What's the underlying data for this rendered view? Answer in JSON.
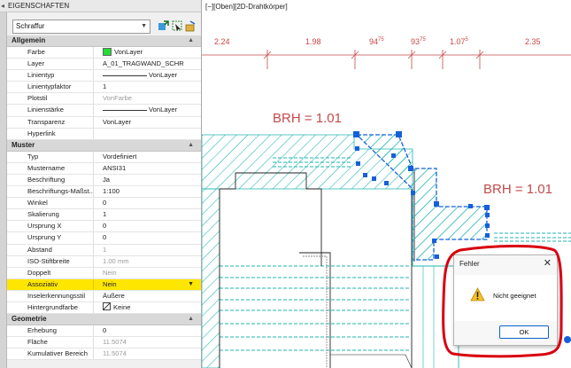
{
  "palette": {
    "title": "EIGENSCHAFTEN",
    "selection": "Schraffur",
    "sections": [
      {
        "name": "Allgemein",
        "rows": [
          {
            "label": "Farbe",
            "value": "VonLayer",
            "kind": "color"
          },
          {
            "label": "Layer",
            "value": "A_01_TRAGWAND_SCHR"
          },
          {
            "label": "Linientyp",
            "value": "VonLayer",
            "kind": "line"
          },
          {
            "label": "Linientypfaktor",
            "value": "1"
          },
          {
            "label": "Plotstil",
            "value": "VonFarbe",
            "readonly": true
          },
          {
            "label": "Linienstärke",
            "value": "VonLayer",
            "kind": "line"
          },
          {
            "label": "Transparenz",
            "value": "VonLayer"
          },
          {
            "label": "Hyperlink",
            "value": ""
          }
        ]
      },
      {
        "name": "Muster",
        "rows": [
          {
            "label": "Typ",
            "value": "Vordefiniert"
          },
          {
            "label": "Mustername",
            "value": "ANSI31"
          },
          {
            "label": "Beschriftung",
            "value": "Ja"
          },
          {
            "label": "Beschriftungs-Maßst...",
            "value": "1:100"
          },
          {
            "label": "Winkel",
            "value": "0"
          },
          {
            "label": "Skalierung",
            "value": "1"
          },
          {
            "label": "Ursprung X",
            "value": "0"
          },
          {
            "label": "Ursprung Y",
            "value": "0"
          },
          {
            "label": "Abstand",
            "value": "1",
            "readonly": true
          },
          {
            "label": "ISO-Stiftbreite",
            "value": "1.00 mm",
            "readonly": true
          },
          {
            "label": "Doppelt",
            "value": "Nein",
            "readonly": true
          },
          {
            "label": "Assoziativ",
            "value": "Nein",
            "highlight": true,
            "dropdown": true
          },
          {
            "label": "Inselerkennungsstil",
            "value": "Äußere"
          },
          {
            "label": "Hintergrundfarbe",
            "value": "Keine",
            "kind": "bgcolor"
          }
        ]
      },
      {
        "name": "Geometrie",
        "rows": [
          {
            "label": "Erhebung",
            "value": "0"
          },
          {
            "label": "Fläche",
            "value": "11.5074",
            "readonly": true
          },
          {
            "label": "Kumulativer Bereich",
            "value": "11.5074",
            "readonly": true
          }
        ]
      }
    ]
  },
  "canvas": {
    "viewport_label": "[−][Oben][2D-Drahtkörper]",
    "dimensions": [
      {
        "main": "2.24",
        "sup": ""
      },
      {
        "main": "1.98",
        "sup": ""
      },
      {
        "main": "94",
        "sup": "75"
      },
      {
        "main": "93",
        "sup": "75"
      },
      {
        "main": "1.07",
        "sup": "5"
      },
      {
        "main": "2.35",
        "sup": ""
      }
    ],
    "annotation_1": "BRH = 1.01",
    "annotation_2": "BRH = 1.01"
  },
  "dialog": {
    "title": "Fehler",
    "message": "Nicht geeignet",
    "ok_label": "OK"
  },
  "colors": {
    "hatch": "#1fb5b0",
    "dimension": "#c44a4a",
    "highlight": "#ffe600",
    "alert_ring": "#d8000f",
    "grip": "#1560d8"
  }
}
